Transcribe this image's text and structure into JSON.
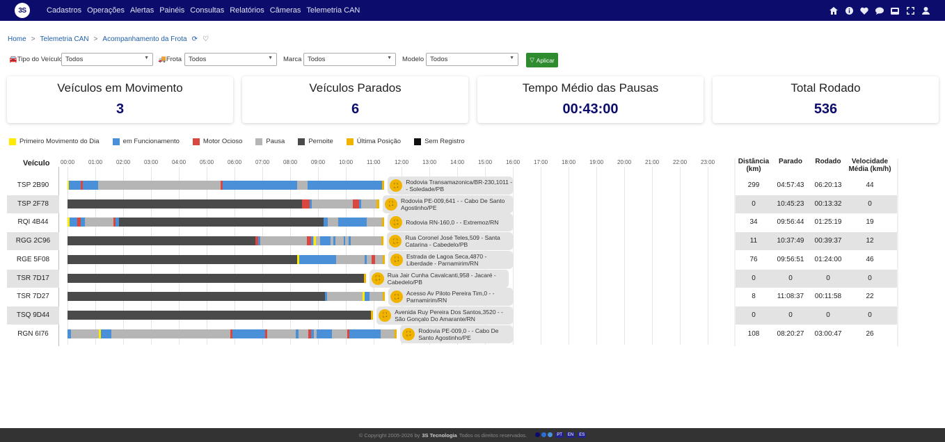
{
  "nav": {
    "logo": "3S",
    "menu": [
      "Cadastros",
      "Operações",
      "Alertas",
      "Painéis",
      "Consultas",
      "Relatórios",
      "Câmeras",
      "Telemetria CAN"
    ],
    "icons": [
      "home-icon",
      "info-icon",
      "heart-icon",
      "chat-icon",
      "inbox-icon",
      "fullscreen-icon",
      "user-icon"
    ]
  },
  "breadcrumb": {
    "home": "Home",
    "level1": "Telemetria CAN",
    "current": "Acompanhamento da Frota",
    "sep": ">"
  },
  "filters": {
    "tipo_label": "Tipo do Veículo",
    "tipo_value": "Todos",
    "frota_label": "Frota",
    "frota_value": "Todos",
    "marca_label": "Marca",
    "marca_value": "Todos",
    "modelo_label": "Modelo",
    "modelo_value": "Todos",
    "apply_label": "Aplicar"
  },
  "cards": [
    {
      "title": "Veículos em Movimento",
      "value": "3"
    },
    {
      "title": "Veículos Parados",
      "value": "6"
    },
    {
      "title": "Tempo Médio das Pausas",
      "value": "00:43:00"
    },
    {
      "title": "Total Rodado",
      "value": "536"
    }
  ],
  "colors": {
    "first_move": "#ffea00",
    "running": "#4a90d9",
    "idle": "#d9473e",
    "pause": "#b5b5b5",
    "overnight": "#4a4a4a",
    "last_pos": "#f0b400",
    "no_record": "#111111",
    "brand": "#0c0c6c"
  },
  "legend": [
    {
      "label": "Primeiro Movimento do Dia",
      "color": "#ffea00"
    },
    {
      "label": "em Funcionamento",
      "color": "#4a90d9"
    },
    {
      "label": "Motor Ocioso",
      "color": "#d9473e"
    },
    {
      "label": "Pausa",
      "color": "#b5b5b5"
    },
    {
      "label": "Pernoite",
      "color": "#4a4a4a"
    },
    {
      "label": "Última Posição",
      "color": "#f0b400"
    },
    {
      "label": "Sem Registro",
      "color": "#111111"
    }
  ],
  "timeline": {
    "vehicle_header": "Veículo",
    "hours": [
      "00:00",
      "01:00",
      "02:00",
      "03:00",
      "04:00",
      "05:00",
      "06:00",
      "07:00",
      "08:00",
      "09:00",
      "10:00",
      "11:00",
      "12:00",
      "13:00",
      "14:00",
      "15:00",
      "16:00",
      "17:00",
      "18:00",
      "19:00",
      "20:00",
      "21:00",
      "22:00",
      "23:00"
    ]
  },
  "table_headers": {
    "distance": "Distância (km)",
    "stopped": "Parado",
    "driven": "Rodado",
    "speed": "Velocidade Média (km/h)"
  },
  "vehicles": [
    {
      "plate": "TSP 2B90",
      "address": "Rodovia Transamazonica/BR-230,1011 - - Soledade/PB",
      "distance": "299",
      "stopped": "04:57:43",
      "driven": "06:20:13",
      "speed": "44",
      "segments": [
        [
          "first_move",
          0,
          0.05
        ],
        [
          "running",
          0.05,
          0.48
        ],
        [
          "idle",
          0.48,
          0.55
        ],
        [
          "running",
          0.55,
          1.1
        ],
        [
          "pause",
          1.1,
          5.5
        ],
        [
          "idle",
          5.5,
          5.57
        ],
        [
          "running",
          5.57,
          8.25
        ],
        [
          "pause",
          8.25,
          8.62
        ],
        [
          "running",
          8.62,
          11.3
        ],
        [
          "last_pos",
          11.3,
          11.38
        ]
      ]
    },
    {
      "plate": "TSP 2F78",
      "address": "Rodovia PE-009,641 - - Cabo De Santo Agostinho/PE",
      "distance": "0",
      "stopped": "10:45:23",
      "driven": "00:13:32",
      "speed": "0",
      "segments": [
        [
          "overnight",
          0,
          8.42
        ],
        [
          "idle",
          8.42,
          8.7
        ],
        [
          "running",
          8.7,
          8.78
        ],
        [
          "pause",
          8.78,
          10.25
        ],
        [
          "idle",
          10.25,
          10.48
        ],
        [
          "running",
          10.48,
          10.55
        ],
        [
          "pause",
          10.55,
          11.1
        ],
        [
          "last_pos",
          11.1,
          11.2
        ]
      ]
    },
    {
      "plate": "RQI 4B44",
      "address": "Rodovia RN-160,0 - - Extremoz/RN",
      "distance": "34",
      "stopped": "09:56:44",
      "driven": "01:25:19",
      "speed": "19",
      "segments": [
        [
          "first_move",
          0,
          0.08
        ],
        [
          "running",
          0.08,
          0.35
        ],
        [
          "idle",
          0.35,
          0.48
        ],
        [
          "running",
          0.48,
          0.62
        ],
        [
          "pause",
          0.62,
          1.65
        ],
        [
          "idle",
          1.65,
          1.72
        ],
        [
          "running",
          1.72,
          1.85
        ],
        [
          "overnight",
          1.85,
          9.2
        ],
        [
          "running",
          9.2,
          9.35
        ],
        [
          "pause",
          9.35,
          9.72
        ],
        [
          "running",
          9.72,
          10.75
        ],
        [
          "pause",
          10.75,
          11.3
        ],
        [
          "last_pos",
          11.3,
          11.38
        ]
      ]
    },
    {
      "plate": "RGG 2C96",
      "address": "Rua Coronel José Teles,509 - Santa Catarina - Cabedelo/PB",
      "distance": "11",
      "stopped": "10:37:49",
      "driven": "00:39:37",
      "speed": "12",
      "segments": [
        [
          "overnight",
          0,
          6.75
        ],
        [
          "idle",
          6.75,
          6.85
        ],
        [
          "running",
          6.85,
          6.92
        ],
        [
          "pause",
          6.92,
          8.6
        ],
        [
          "idle",
          8.6,
          8.75
        ],
        [
          "running",
          8.75,
          8.82
        ],
        [
          "pause",
          8.82,
          8.85
        ],
        [
          "first_move",
          8.85,
          8.93
        ],
        [
          "pause",
          8.93,
          9.08
        ],
        [
          "running",
          9.08,
          9.45
        ],
        [
          "pause",
          9.45,
          9.55
        ],
        [
          "running",
          9.55,
          9.62
        ],
        [
          "pause",
          9.62,
          9.92
        ],
        [
          "running",
          9.92,
          9.98
        ],
        [
          "pause",
          9.98,
          10.1
        ],
        [
          "running",
          10.1,
          10.18
        ],
        [
          "pause",
          10.18,
          11.28
        ],
        [
          "last_pos",
          11.28,
          11.36
        ]
      ]
    },
    {
      "plate": "RGE 5F08",
      "address": "Estrada de Lagoa Seca,4870 - Liberdade - Parnamirim/RN",
      "distance": "76",
      "stopped": "09:56:51",
      "driven": "01:24:00",
      "speed": "46",
      "segments": [
        [
          "overnight",
          0,
          8.25
        ],
        [
          "first_move",
          8.25,
          8.32
        ],
        [
          "running",
          8.32,
          9.65
        ],
        [
          "pause",
          9.65,
          10.68
        ],
        [
          "running",
          10.68,
          10.75
        ],
        [
          "pause",
          10.75,
          10.92
        ],
        [
          "idle",
          10.92,
          11.05
        ],
        [
          "pause",
          11.05,
          11.32
        ],
        [
          "last_pos",
          11.32,
          11.4
        ]
      ]
    },
    {
      "plate": "TSR 7D17",
      "address": "Rua Jair Cunha Cavalcanti,958 - Jacaré - Cabedelo/PB",
      "distance": "0",
      "stopped": "0",
      "driven": "0",
      "speed": "0",
      "segments": [
        [
          "overnight",
          0,
          10.65
        ],
        [
          "last_pos",
          10.65,
          10.72
        ]
      ]
    },
    {
      "plate": "TSR 7D27",
      "address": "Acesso Av Piloto Pereira Tim,0 - - Parnamirim/RN",
      "distance": "8",
      "stopped": "11:08:37",
      "driven": "00:11:58",
      "speed": "22",
      "segments": [
        [
          "overnight",
          0,
          9.25
        ],
        [
          "running",
          9.25,
          9.32
        ],
        [
          "pause",
          9.32,
          10.6
        ],
        [
          "first_move",
          10.6,
          10.68
        ],
        [
          "running",
          10.68,
          10.85
        ],
        [
          "pause",
          10.85,
          11.32
        ],
        [
          "last_pos",
          11.32,
          11.4
        ]
      ]
    },
    {
      "plate": "TSQ 9D44",
      "address": "Avenida Ruy Pereira Dos Santos,3520 - - São Gonçalo Do Amarante/RN",
      "distance": "0",
      "stopped": "0",
      "driven": "0",
      "speed": "0",
      "segments": [
        [
          "overnight",
          0,
          10.9
        ],
        [
          "last_pos",
          10.9,
          10.98
        ]
      ]
    },
    {
      "plate": "RGN 6I76",
      "address": "Rodovia PE-009,0 - - Cabo De Santo Agostinho/PE",
      "distance": "108",
      "stopped": "08:20:27",
      "driven": "03:00:47",
      "speed": "26",
      "segments": [
        [
          "running",
          0,
          0.12
        ],
        [
          "pause",
          0.12,
          1.12
        ],
        [
          "first_move",
          1.12,
          1.2
        ],
        [
          "running",
          1.2,
          1.58
        ],
        [
          "pause",
          1.58,
          5.85
        ],
        [
          "idle",
          5.85,
          5.92
        ],
        [
          "running",
          5.92,
          7.1
        ],
        [
          "idle",
          7.1,
          7.18
        ],
        [
          "pause",
          7.18,
          8.2
        ],
        [
          "running",
          8.2,
          8.3
        ],
        [
          "pause",
          8.3,
          8.65
        ],
        [
          "idle",
          8.65,
          8.75
        ],
        [
          "running",
          8.75,
          8.85
        ],
        [
          "pause",
          8.85,
          8.95
        ],
        [
          "running",
          8.95,
          9.5
        ],
        [
          "pause",
          9.5,
          10.05
        ],
        [
          "idle",
          10.05,
          10.12
        ],
        [
          "running",
          10.12,
          11.25
        ],
        [
          "pause",
          11.25,
          11.75
        ],
        [
          "last_pos",
          11.75,
          11.83
        ]
      ]
    }
  ],
  "footer": {
    "text": "© Copyright 2005-2026 by",
    "company": "3S Tecnologia",
    "rights": "Todos os direitos reservados.",
    "langs": [
      "PT",
      "EN",
      "ES"
    ]
  }
}
